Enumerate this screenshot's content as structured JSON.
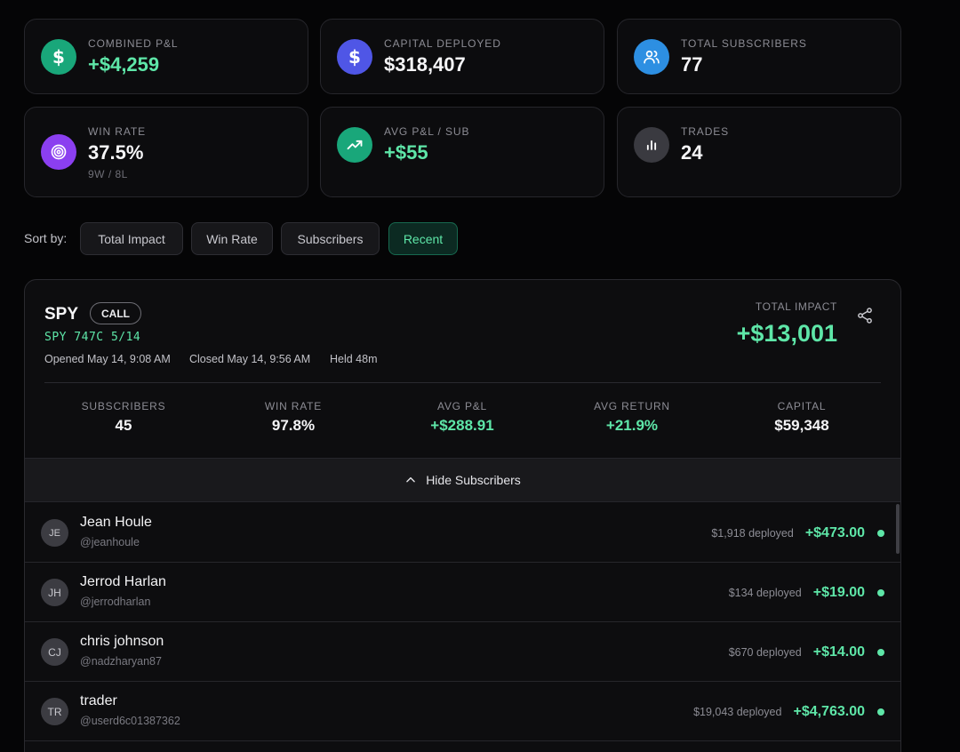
{
  "stats": [
    {
      "label": "COMBINED P&L",
      "value": "+$4,259",
      "icon": "dollar-icon",
      "color": "#19a77a",
      "tone": "green"
    },
    {
      "label": "CAPITAL DEPLOYED",
      "value": "$318,407",
      "icon": "dollar-icon",
      "color": "#4f56e6",
      "tone": "white"
    },
    {
      "label": "TOTAL SUBSCRIBERS",
      "value": "77",
      "icon": "users-icon",
      "color": "#2d8fe2",
      "tone": "white"
    },
    {
      "label": "WIN RATE",
      "value": "37.5%",
      "sub": "9W / 8L",
      "icon": "target-icon",
      "color": "#8b3ff0",
      "tone": "white"
    },
    {
      "label": "AVG P&L / SUB",
      "value": "+$55",
      "icon": "trending-up-icon",
      "color": "#19a77a",
      "tone": "green"
    },
    {
      "label": "TRADES",
      "value": "24",
      "icon": "bar-chart-icon",
      "color": "#3a3a40",
      "tone": "white"
    }
  ],
  "sort": {
    "label": "Sort by:",
    "options": [
      "Total Impact",
      "Win Rate",
      "Subscribers",
      "Recent"
    ],
    "active": "Recent"
  },
  "trade": {
    "ticker": "SPY",
    "type": "CALL",
    "contract": "SPY 747C 5/14",
    "opened": "Opened May 14, 9:08 AM",
    "closed": "Closed May 14, 9:56 AM",
    "held": "Held 48m",
    "impact_label": "TOTAL IMPACT",
    "impact_value": "+$13,001",
    "metrics": [
      {
        "label": "SUBSCRIBERS",
        "value": "45",
        "tone": "white"
      },
      {
        "label": "WIN RATE",
        "value": "97.8%",
        "tone": "white"
      },
      {
        "label": "AVG P&L",
        "value": "+$288.91",
        "tone": "green"
      },
      {
        "label": "AVG RETURN",
        "value": "+21.9%",
        "tone": "green"
      },
      {
        "label": "CAPITAL",
        "value": "$59,348",
        "tone": "white"
      }
    ],
    "toggle_label": "Hide Subscribers"
  },
  "subscribers": [
    {
      "initials": "JE",
      "name": "Jean Houle",
      "handle": "@jeanhoule",
      "deployed": "$1,918 deployed",
      "pnl": "+$473.00"
    },
    {
      "initials": "JH",
      "name": "Jerrod Harlan",
      "handle": "@jerrodharlan",
      "deployed": "$134 deployed",
      "pnl": "+$19.00"
    },
    {
      "initials": "CJ",
      "name": "chris johnson",
      "handle": "@nadzharyan87",
      "deployed": "$670 deployed",
      "pnl": "+$14.00"
    },
    {
      "initials": "TR",
      "name": "trader",
      "handle": "@userd6c01387362",
      "deployed": "$19,043 deployed",
      "pnl": "+$4,763.00"
    }
  ]
}
